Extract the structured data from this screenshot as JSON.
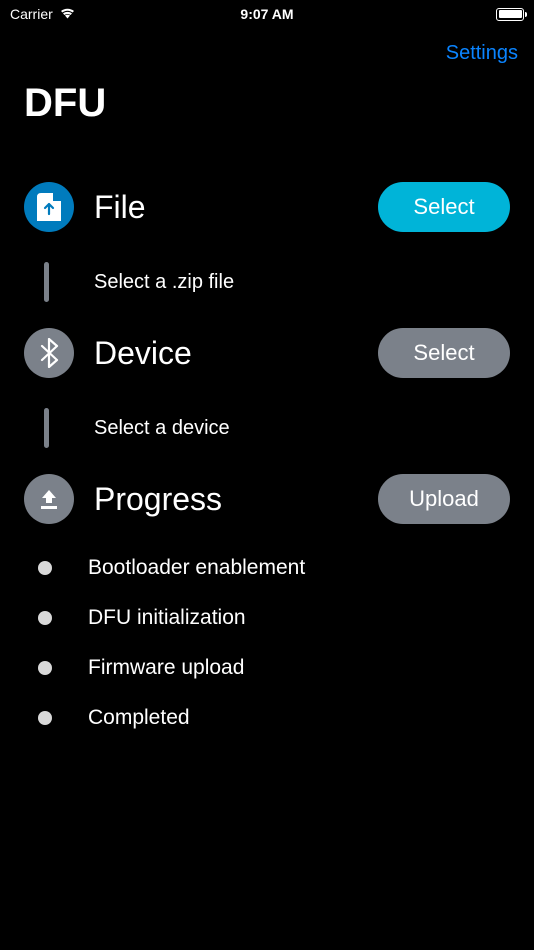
{
  "status_bar": {
    "carrier": "Carrier",
    "time": "9:07 AM"
  },
  "nav": {
    "settings_label": "Settings"
  },
  "page": {
    "title": "DFU"
  },
  "sections": {
    "file": {
      "title": "File",
      "button": "Select",
      "subtext": "Select a .zip file"
    },
    "device": {
      "title": "Device",
      "button": "Select",
      "subtext": "Select a device"
    },
    "progress": {
      "title": "Progress",
      "button": "Upload",
      "steps": {
        "0": "Bootloader enablement",
        "1": "DFU initialization",
        "2": "Firmware upload",
        "3": "Completed"
      }
    }
  }
}
